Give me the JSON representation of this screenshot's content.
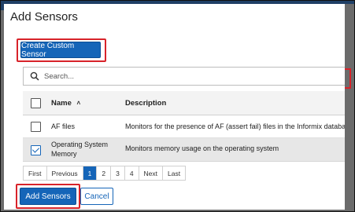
{
  "dialog": {
    "title": "Add Sensors",
    "close_glyph": "×",
    "create_custom_label": "Create Custom Sensor",
    "search_placeholder": "Search...",
    "add_label": "Add Sensors",
    "cancel_label": "Cancel"
  },
  "table": {
    "headers": {
      "name": "Name",
      "sort_indicator": "˄",
      "description": "Description"
    },
    "rows": [
      {
        "name": "AF files",
        "description": "Monitors for the presence of AF (assert fail) files in the Informix database",
        "checked": false
      },
      {
        "name_line1": "Operating System",
        "name_line2": "Memory",
        "description": "Monitors memory usage on the operating system",
        "checked": true
      }
    ]
  },
  "pagination": {
    "first": "First",
    "previous": "Previous",
    "pages": [
      "1",
      "2",
      "3",
      "4"
    ],
    "active_page": "1",
    "next": "Next",
    "last": "Last"
  },
  "colors": {
    "primary": "#1565b8",
    "highlight": "#d8232a",
    "selected_row": "#e7e7e7"
  }
}
